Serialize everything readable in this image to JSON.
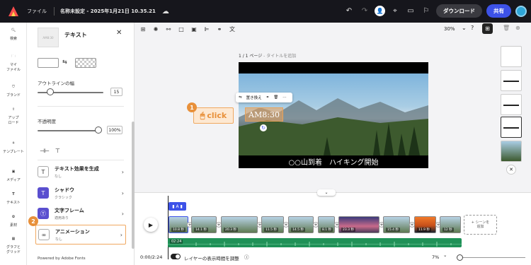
{
  "topbar": {
    "file_menu": "ファイル",
    "doc_title": "名称未設定 - 2025年1月21日 10.35.21",
    "download_label": "ダウンロード",
    "share_label": "共有"
  },
  "rail": [
    {
      "label": "検索",
      "icon": "search-icon"
    },
    {
      "label": "マイ\nファイル",
      "icon": "folder-icon"
    },
    {
      "label": "ブランド",
      "icon": "brand-icon"
    },
    {
      "label": "アップ\nロード",
      "icon": "upload-icon"
    },
    {
      "label": "テンプレート",
      "icon": "template-icon"
    },
    {
      "label": "メディア",
      "icon": "media-icon"
    },
    {
      "label": "テキスト",
      "icon": "text-icon"
    },
    {
      "label": "素材",
      "icon": "elements-icon"
    },
    {
      "label": "グラフと\nグリッド",
      "icon": "grid-icon"
    }
  ],
  "panel": {
    "thumb_text": "AM8:30",
    "title": "テキスト",
    "outline_width_label": "アウトラインの幅",
    "outline_width_value": "15",
    "opacity_label": "不透明度",
    "opacity_value": "100%",
    "rows": [
      {
        "title": "テキスト効果を生成",
        "sub": "なし",
        "color": "#ffffff",
        "glyph": "T"
      },
      {
        "title": "シャドウ",
        "sub": "クラシック",
        "color": "#5a4fcf",
        "glyph": "T"
      },
      {
        "title": "文字フレーム",
        "sub": "適用あり",
        "color": "#5a4fcf",
        "glyph": "T"
      },
      {
        "title": "アニメーション",
        "sub": "なし",
        "color": "#ffffff",
        "glyph": "∞"
      }
    ],
    "footer": "Powered by Adobe Fonts"
  },
  "canvas": {
    "zoom": "30%",
    "page_label": "1 / 1 ページ",
    "page_hint": " - タイトルを追加",
    "context_menu": [
      "置き換え"
    ],
    "selected_text": "AM8:30",
    "caption": "○○山到着　ハイキング開始",
    "click_annotation": "click"
  },
  "annotations": {
    "badge1": "1",
    "badge2": "2"
  },
  "timeline": {
    "clips": [
      "10.8 秒",
      "14.1 秒",
      "20.3 秒",
      "11.5 秒",
      "14.5 秒",
      "8.1 秒",
      "23.3 秒",
      "15.4 秒",
      "11.9 秒",
      "12 秒"
    ],
    "add_scene": "+ シーンを\n追加",
    "audio_time": "02:24",
    "time": "0:00/2:24",
    "layer_toggle_label": "レイヤーの表示時間を調整",
    "zoom": "7%"
  },
  "colors": {
    "topbar_bg": "#16161c",
    "accent": "#3d52e8",
    "orange": "#e8903a",
    "audio": "#1f9157"
  }
}
